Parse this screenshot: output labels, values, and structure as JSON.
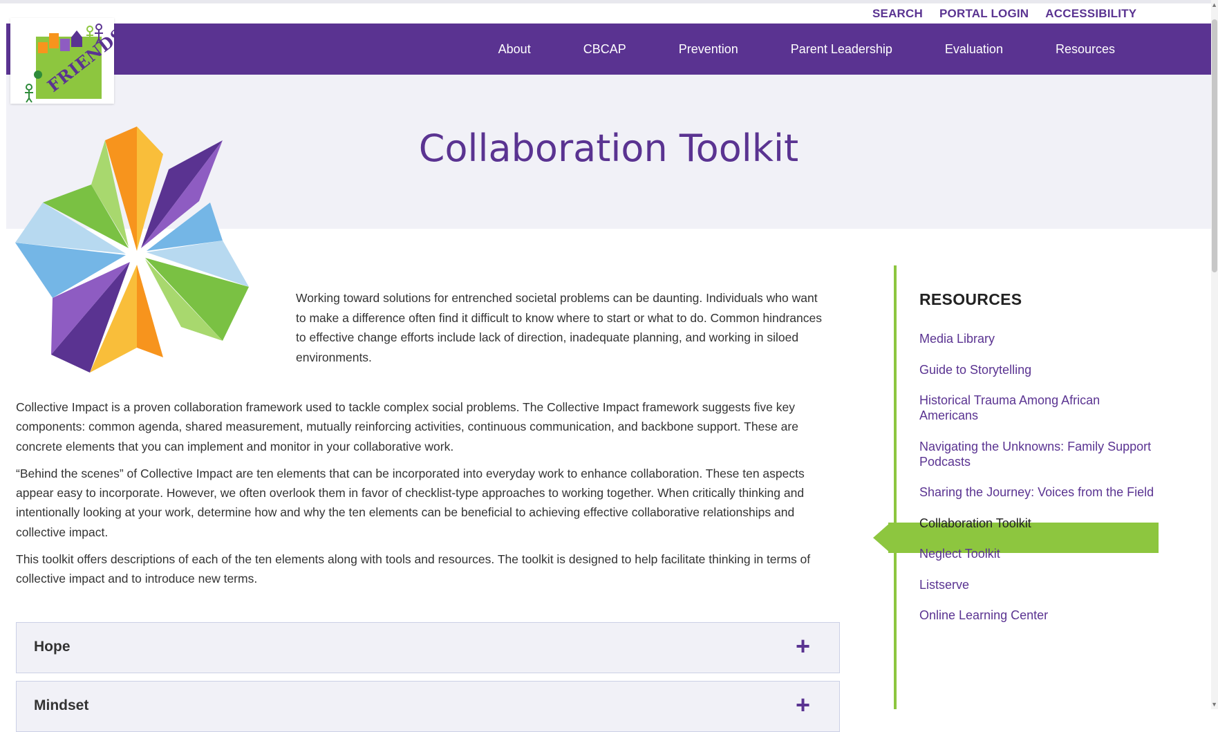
{
  "utility_nav": [
    "SEARCH",
    "PORTAL LOGIN",
    "ACCESSIBILITY"
  ],
  "logo": {
    "text": "FRIENDS"
  },
  "main_nav": [
    "About",
    "CBCAP",
    "Prevention",
    "Parent Leadership",
    "Evaluation",
    "Resources"
  ],
  "page": {
    "title": "Collaboration Toolkit"
  },
  "intro": "Working toward solutions for entrenched societal problems can be daunting. Individuals who want to make a difference often find it difficult to know where to start or what to do. Common hindrances to effective change efforts include lack of direction, inadequate planning, and working in siloed environments.",
  "paragraphs": [
    "Collective Impact is a proven collaboration framework used to tackle complex social problems. The Collective Impact framework suggests five key components: common agenda, shared measurement, mutually reinforcing activities, continuous communication, and backbone support. These are concrete elements that you can implement and monitor in your collaborative work.",
    "“Behind the scenes” of Collective Impact are ten elements that can be incorporated into everyday work to enhance collaboration. These ten aspects appear easy to incorporate. However, we often overlook them in favor of checklist-type approaches to working together. When critically thinking and intentionally looking at your work, determine how and why the ten elements can be beneficial to achieving effective collaborative relationships and collective impact.",
    "This toolkit offers descriptions of each of the ten elements along with tools and resources. The toolkit is designed to help facilitate thinking in terms of collective impact and to introduce new terms."
  ],
  "accordions": [
    {
      "label": "Hope",
      "icon": "+"
    },
    {
      "label": "Mindset",
      "icon": "+"
    }
  ],
  "sidebar": {
    "title": "RESOURCES",
    "items": [
      "Media Library",
      "Guide to Storytelling",
      "Historical Trauma Among African Americans",
      "Navigating the Unknowns: Family Support Podcasts",
      "Sharing the Journey: Voices from the Field",
      "Collaboration Toolkit",
      "Neglect Toolkit",
      "Listserve",
      "Online Learning Center"
    ],
    "active_item": "Collaboration Toolkit"
  },
  "colors": {
    "brand_purple": "#5a3391",
    "accent_green": "#8dc63f",
    "hero_bg": "#f1f1f7"
  }
}
